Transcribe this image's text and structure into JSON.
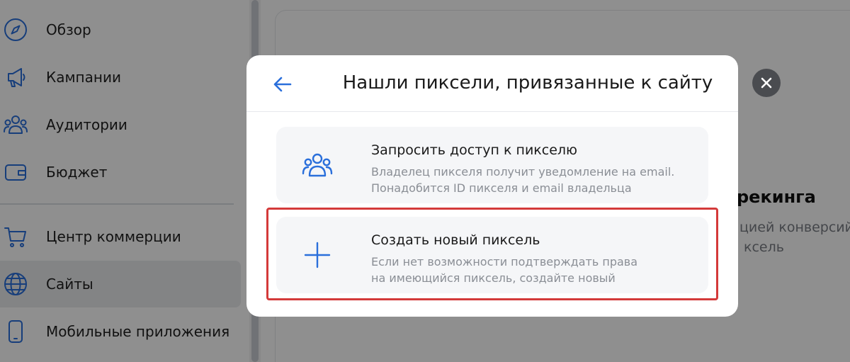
{
  "sidebar": {
    "items": [
      {
        "label": "Обзор",
        "icon": "compass-icon"
      },
      {
        "label": "Кампании",
        "icon": "megaphone-icon"
      },
      {
        "label": "Аудитории",
        "icon": "users-icon"
      },
      {
        "label": "Бюджет",
        "icon": "wallet-icon"
      },
      {
        "label": "Центр коммерции",
        "icon": "cart-icon"
      },
      {
        "label": "Сайты",
        "icon": "globe-icon",
        "active": true
      },
      {
        "label": "Мобильные приложения",
        "icon": "phone-icon"
      }
    ]
  },
  "background": {
    "heading_fragment": "рекинга",
    "text_line_1": "цией конверсий",
    "text_line_2": "ксель"
  },
  "modal": {
    "title": "Нашли пиксели, привязанные к сайту",
    "options": [
      {
        "title": "Запросить доступ к пикселю",
        "desc_line_1": "Владелец пикселя получит уведомление на email.",
        "desc_line_2": "Понадобится ID пикселя и email владельца",
        "icon": "users-icon"
      },
      {
        "title": "Создать новый пиксель",
        "desc_line_1": "Если нет возможности подтверждать права",
        "desc_line_2": "на имеющийся пиксель, создайте новый",
        "icon": "plus-icon"
      }
    ]
  },
  "colors": {
    "accent": "#2a6fdb",
    "highlight": "#d43a3a",
    "overlay": "rgba(0,0,0,0.44)"
  }
}
